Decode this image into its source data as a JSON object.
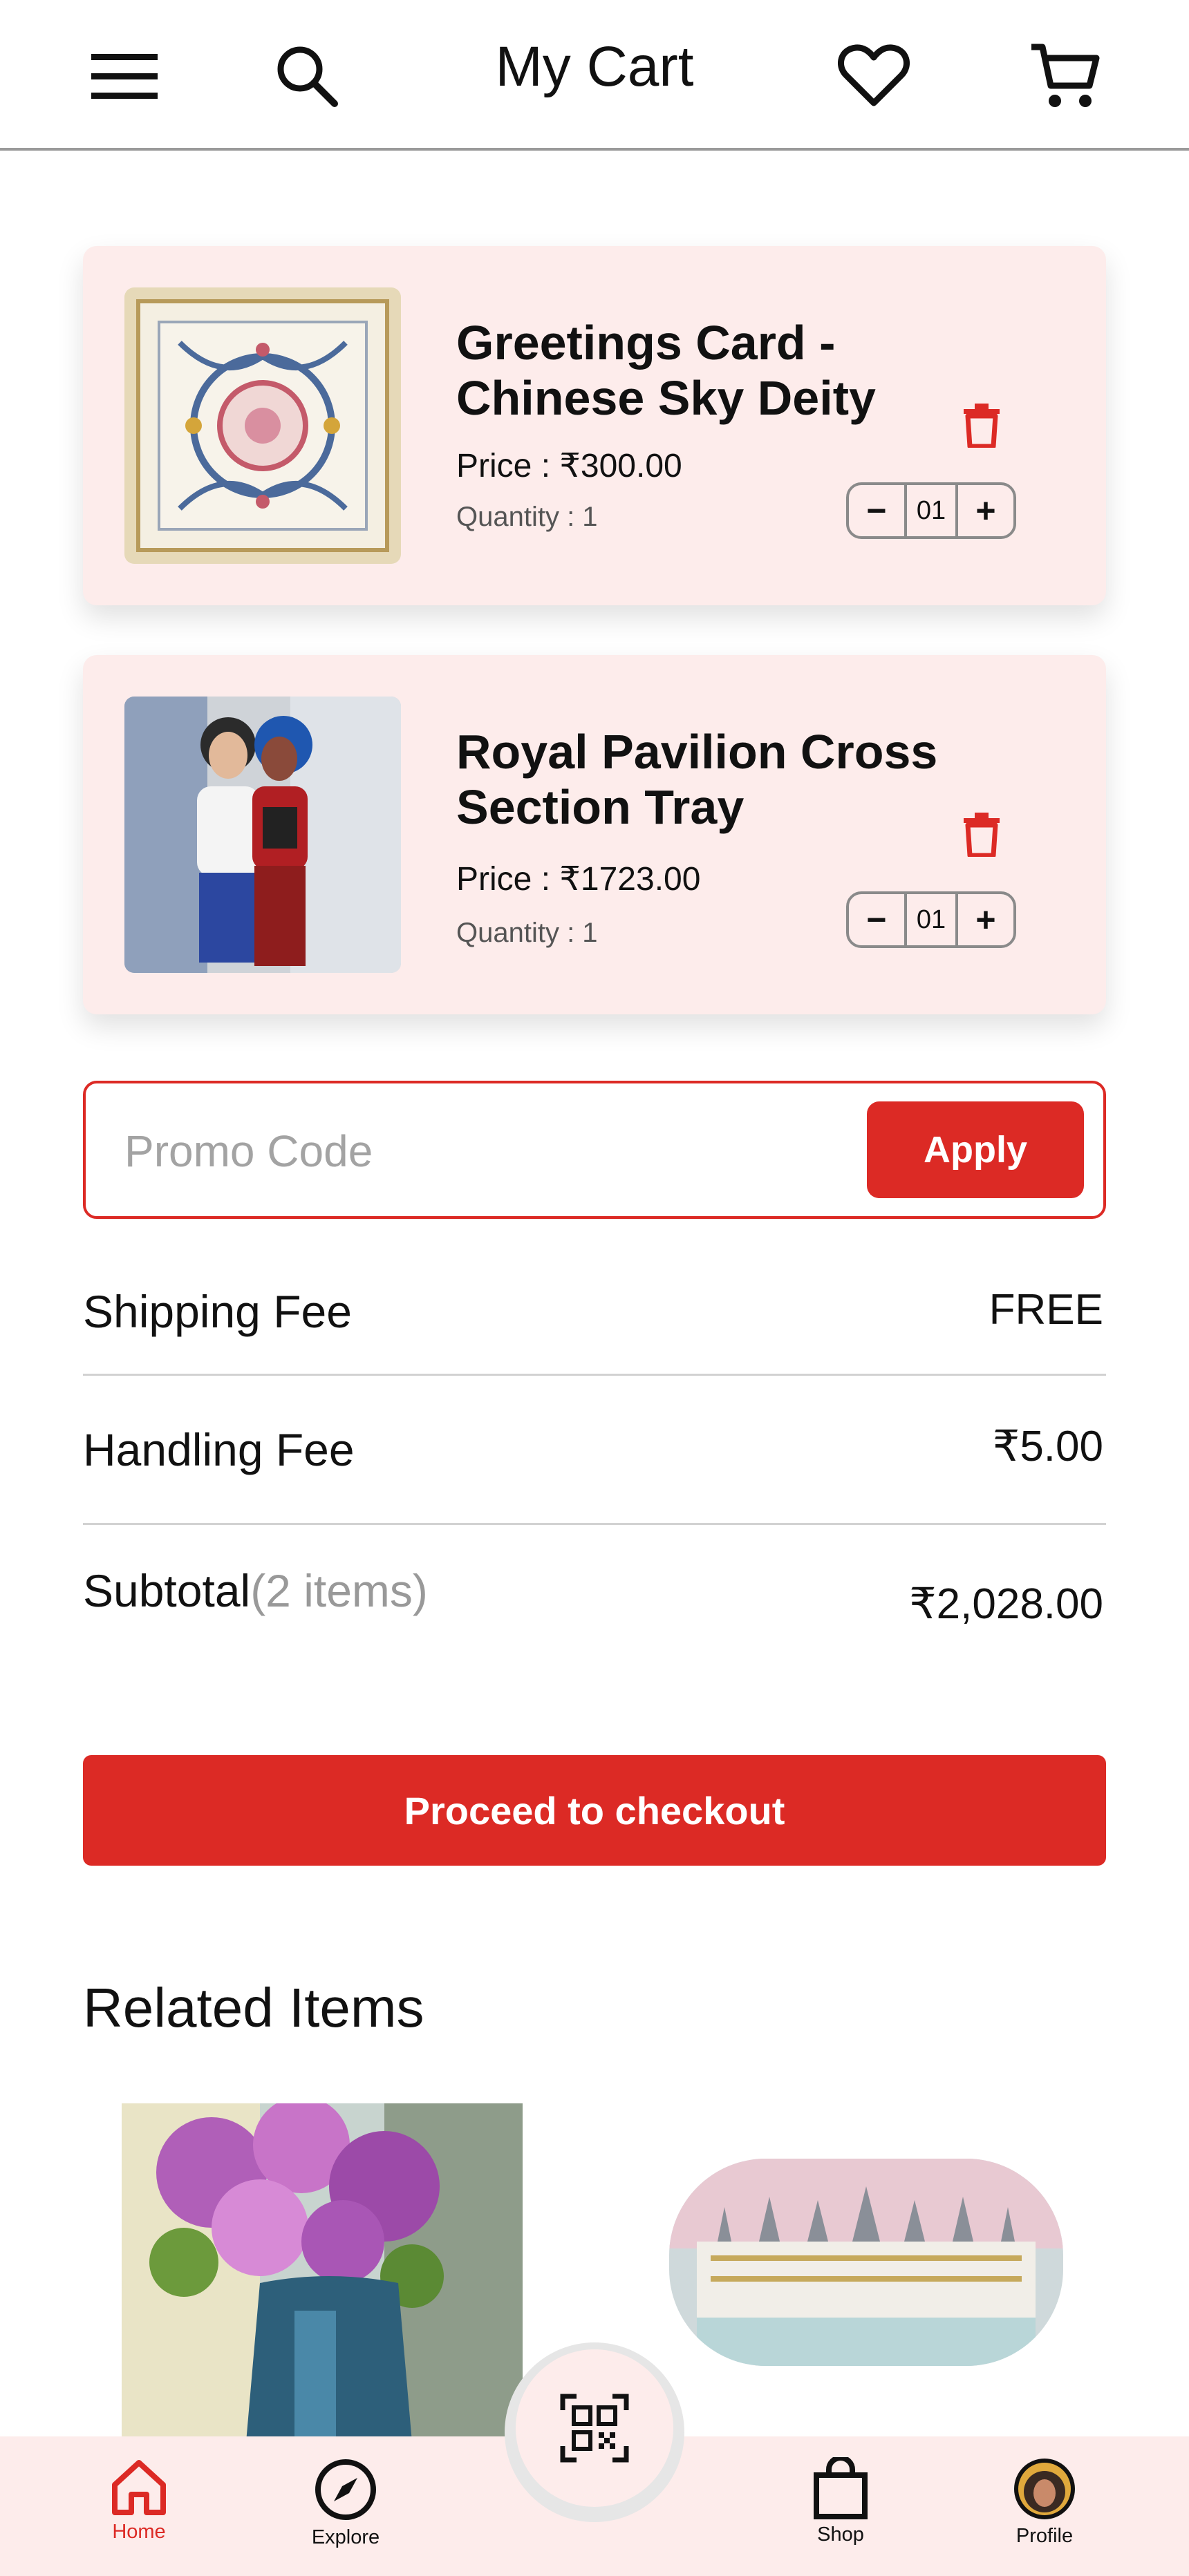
{
  "header": {
    "title": "My Cart",
    "icons": [
      "menu-icon",
      "search-icon",
      "heart-icon",
      "cart-icon"
    ]
  },
  "cart": {
    "items": [
      {
        "title": "Greetings Card - Chinese Sky Deity",
        "price": "Price : ₹300.00",
        "quantity_text": "Quantity : 1",
        "stepper_value": "01",
        "minus": "−",
        "plus": "+"
      },
      {
        "title": "Royal Pavilion Cross Section Tray",
        "price": "Price : ₹1723.00",
        "quantity_text": "Quantity : 1",
        "stepper_value": "01",
        "minus": "−",
        "plus": "+"
      }
    ]
  },
  "promo": {
    "placeholder": "Promo Code",
    "value": "",
    "apply_label": "Apply"
  },
  "fees": {
    "shipping_label": "Shipping Fee",
    "shipping_value": "FREE",
    "handling_label": "Handling Fee",
    "handling_value": "₹5.00",
    "subtotal_label": "Subtotal",
    "subtotal_count": "(2 items)",
    "subtotal_value": "₹2,028.00"
  },
  "checkout": {
    "label": "Proceed to checkout"
  },
  "related": {
    "title": "Related Items"
  },
  "bottom_nav": {
    "items": [
      {
        "label": "Home",
        "icon": "home-icon",
        "active": true
      },
      {
        "label": "Explore",
        "icon": "compass-icon",
        "active": false
      },
      {
        "label": "Shop",
        "icon": "shopping-bag-icon",
        "active": false
      },
      {
        "label": "Profile",
        "icon": "avatar",
        "active": false
      }
    ],
    "center_icon": "qr-scan-icon"
  },
  "colors": {
    "accent": "#dc2a25",
    "card_bg": "#fdeceb",
    "nav_bg": "#fdeceb",
    "muted_text": "#999999"
  }
}
